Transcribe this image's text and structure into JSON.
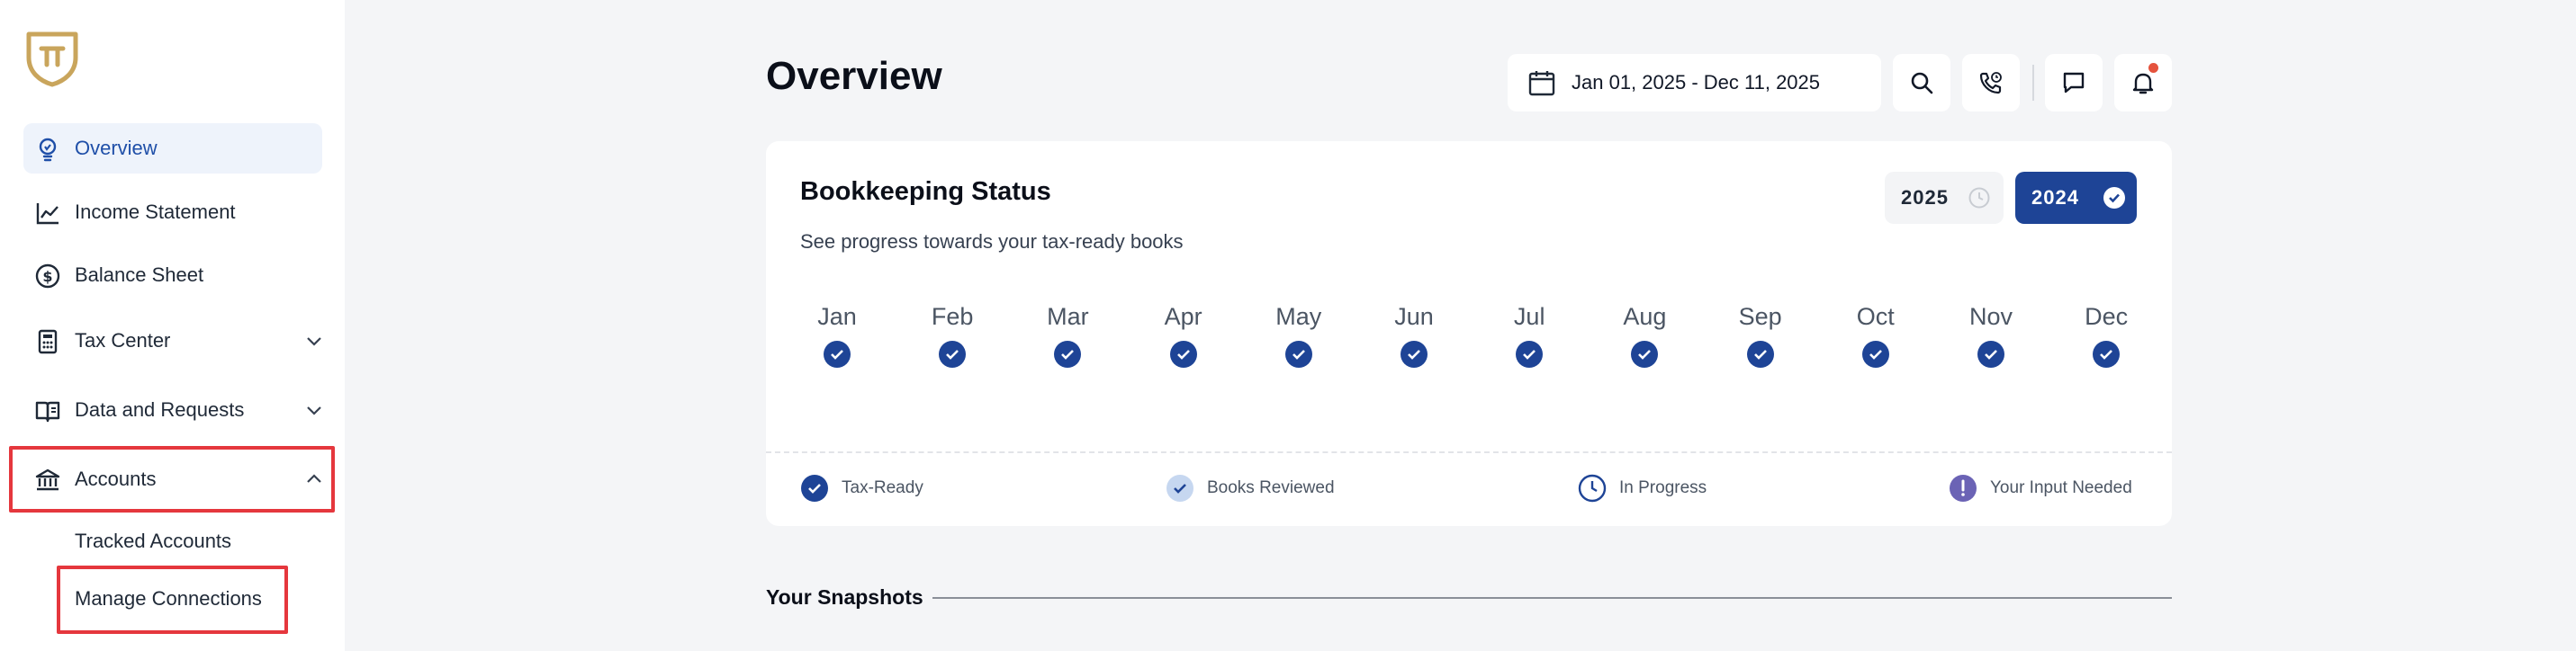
{
  "sidebar": {
    "items": [
      {
        "label": "Overview",
        "icon": "lightbulb-icon"
      },
      {
        "label": "Income Statement",
        "icon": "line-chart-icon"
      },
      {
        "label": "Balance Sheet",
        "icon": "dollar-circle-icon"
      },
      {
        "label": "Tax Center",
        "icon": "calculator-icon"
      },
      {
        "label": "Data and Requests",
        "icon": "book-icon"
      },
      {
        "label": "Accounts",
        "icon": "bank-icon"
      }
    ],
    "accounts_sub": [
      {
        "label": "Tracked Accounts"
      },
      {
        "label": "Manage Connections"
      }
    ]
  },
  "header": {
    "title": "Overview",
    "date_range": "Jan 01, 2025 - Dec 11, 2025"
  },
  "bookkeeping": {
    "title": "Bookkeeping Status",
    "subtitle": "See progress towards your tax-ready books",
    "years": [
      {
        "label": "2025",
        "state": "in-progress"
      },
      {
        "label": "2024",
        "state": "selected-complete"
      }
    ],
    "months": [
      {
        "label": "Jan",
        "status": "tax-ready"
      },
      {
        "label": "Feb",
        "status": "tax-ready"
      },
      {
        "label": "Mar",
        "status": "tax-ready"
      },
      {
        "label": "Apr",
        "status": "tax-ready"
      },
      {
        "label": "May",
        "status": "tax-ready"
      },
      {
        "label": "Jun",
        "status": "tax-ready"
      },
      {
        "label": "Jul",
        "status": "tax-ready"
      },
      {
        "label": "Aug",
        "status": "tax-ready"
      },
      {
        "label": "Sep",
        "status": "tax-ready"
      },
      {
        "label": "Oct",
        "status": "tax-ready"
      },
      {
        "label": "Nov",
        "status": "tax-ready"
      },
      {
        "label": "Dec",
        "status": "tax-ready"
      }
    ],
    "legend": [
      {
        "label": "Tax-Ready"
      },
      {
        "label": "Books Reviewed"
      },
      {
        "label": "In Progress"
      },
      {
        "label": "Your Input Needed"
      }
    ]
  },
  "snapshots": {
    "title": "Your Snapshots"
  },
  "colors": {
    "brand_gold": "#c9a55c",
    "primary_blue": "#1e4496",
    "highlight_red": "#e5373d",
    "input_needed_purple": "#6b63b5"
  }
}
